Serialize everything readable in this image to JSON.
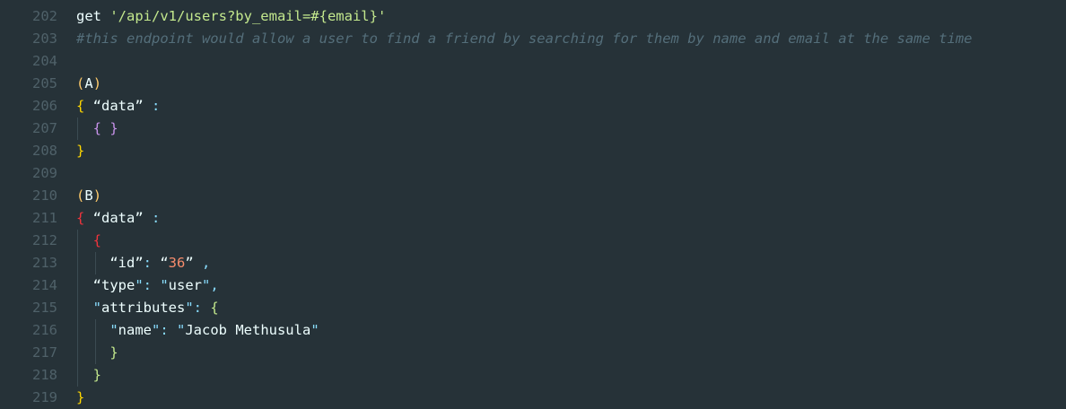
{
  "colors": {
    "background": "#263238",
    "line_number": "#4f6169",
    "text": "#eeffff",
    "string": "#c3e88d",
    "comment": "#546e7a",
    "bracket_yellow": "#ffd700",
    "bracket_purple": "#c792ea",
    "bracket_red": "#f0343c",
    "punctuation": "#89ddff",
    "number": "#f78c6c"
  },
  "lines": [
    {
      "num": "202",
      "guides": 0,
      "tokens": [
        {
          "text": "get ",
          "cls": "tok-plain"
        },
        {
          "text": "'/api/v1/users?by_email=#{email}'",
          "cls": "tok-string"
        }
      ]
    },
    {
      "num": "203",
      "guides": 0,
      "tokens": [
        {
          "text": "#this endpoint would allow a user to find a friend by searching for them by name and email at the same time",
          "cls": "tok-comment"
        }
      ]
    },
    {
      "num": "204",
      "guides": 0,
      "tokens": []
    },
    {
      "num": "205",
      "guides": 0,
      "tokens": [
        {
          "text": "(",
          "cls": "tok-paren"
        },
        {
          "text": "A",
          "cls": "tok-plain"
        },
        {
          "text": ")",
          "cls": "tok-paren"
        }
      ]
    },
    {
      "num": "206",
      "guides": 0,
      "tokens": [
        {
          "text": "{",
          "cls": "tok-brace-y"
        },
        {
          "text": " “data” ",
          "cls": "tok-plain"
        },
        {
          "text": ":",
          "cls": "tok-punct"
        }
      ]
    },
    {
      "num": "207",
      "guides": 1,
      "tokens": [
        {
          "text": "  ",
          "cls": "tok-plain"
        },
        {
          "text": "{ }",
          "cls": "tok-brace-p"
        }
      ]
    },
    {
      "num": "208",
      "guides": 0,
      "tokens": [
        {
          "text": "}",
          "cls": "tok-brace-y"
        }
      ]
    },
    {
      "num": "209",
      "guides": 0,
      "tokens": []
    },
    {
      "num": "210",
      "guides": 0,
      "tokens": [
        {
          "text": "(",
          "cls": "tok-paren"
        },
        {
          "text": "B",
          "cls": "tok-plain"
        },
        {
          "text": ")",
          "cls": "tok-paren"
        }
      ]
    },
    {
      "num": "211",
      "guides": 0,
      "tokens": [
        {
          "text": "{",
          "cls": "tok-brace-r"
        },
        {
          "text": " “data” ",
          "cls": "tok-plain"
        },
        {
          "text": ":",
          "cls": "tok-punct"
        }
      ]
    },
    {
      "num": "212",
      "guides": 1,
      "tokens": [
        {
          "text": "  ",
          "cls": "tok-plain"
        },
        {
          "text": "{",
          "cls": "tok-brace-r"
        }
      ]
    },
    {
      "num": "213",
      "guides": 2,
      "tokens": [
        {
          "text": "    “id”",
          "cls": "tok-plain"
        },
        {
          "text": ": ",
          "cls": "tok-punct"
        },
        {
          "text": "“",
          "cls": "tok-plain"
        },
        {
          "text": "36",
          "cls": "tok-num"
        },
        {
          "text": "” ",
          "cls": "tok-plain"
        },
        {
          "text": ",",
          "cls": "tok-punct"
        }
      ]
    },
    {
      "num": "214",
      "guides": 1,
      "tokens": [
        {
          "text": "  “type",
          "cls": "tok-plain"
        },
        {
          "text": "\": \"",
          "cls": "tok-punct"
        },
        {
          "text": "user",
          "cls": "tok-plain"
        },
        {
          "text": "\",",
          "cls": "tok-punct"
        }
      ]
    },
    {
      "num": "215",
      "guides": 1,
      "tokens": [
        {
          "text": "  ",
          "cls": "tok-plain"
        },
        {
          "text": "\"",
          "cls": "tok-punct"
        },
        {
          "text": "attributes",
          "cls": "tok-plain"
        },
        {
          "text": "\": ",
          "cls": "tok-punct"
        },
        {
          "text": "{",
          "cls": "tok-string"
        }
      ]
    },
    {
      "num": "216",
      "guides": 2,
      "tokens": [
        {
          "text": "    ",
          "cls": "tok-plain"
        },
        {
          "text": "\"",
          "cls": "tok-punct"
        },
        {
          "text": "name",
          "cls": "tok-plain"
        },
        {
          "text": "\": \"",
          "cls": "tok-punct"
        },
        {
          "text": "Jacob Methusula",
          "cls": "tok-plain"
        },
        {
          "text": "\"",
          "cls": "tok-punct"
        }
      ]
    },
    {
      "num": "217",
      "guides": 2,
      "tokens": [
        {
          "text": "    ",
          "cls": "tok-plain"
        },
        {
          "text": "}",
          "cls": "tok-string"
        }
      ]
    },
    {
      "num": "218",
      "guides": 1,
      "tokens": [
        {
          "text": "  ",
          "cls": "tok-plain"
        },
        {
          "text": "}",
          "cls": "tok-string"
        }
      ]
    },
    {
      "num": "219",
      "guides": 0,
      "tokens": [
        {
          "text": "}",
          "cls": "tok-brace-y"
        }
      ]
    }
  ]
}
